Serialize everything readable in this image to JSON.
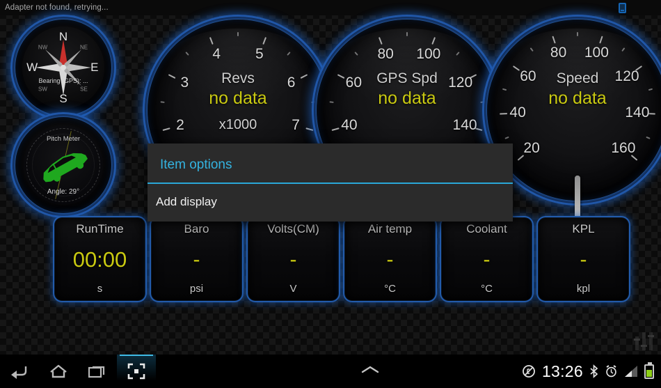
{
  "statusbar": {
    "message": "Adapter not found, retrying...",
    "tablet_icon": "tablet-icon"
  },
  "compass": {
    "name": "Compass",
    "north": "N",
    "east": "E",
    "south": "S",
    "west": "W",
    "nw": "NW",
    "ne": "NE",
    "sw": "SW",
    "se": "SE",
    "bearing": "Bearing (GPS): ..."
  },
  "pitch": {
    "title": "Pitch Meter",
    "angle": "Angle: 29°",
    "angle_value": 29
  },
  "gauges": [
    {
      "id": "revs",
      "title": "Revs",
      "value": "no data",
      "sub": "x1000",
      "ticks": [
        "2",
        "3",
        "4",
        "5",
        "6",
        "7"
      ],
      "needle_value": 0
    },
    {
      "id": "gps-speed",
      "title": "GPS Spd",
      "value": "no data",
      "sub": "",
      "ticks": [
        "40",
        "60",
        "80",
        "100",
        "120",
        "140"
      ],
      "needle_value": 0
    },
    {
      "id": "speed",
      "title": "Speed",
      "value": "no data",
      "sub": "",
      "ticks": [
        "20",
        "40",
        "60",
        "80",
        "100",
        "120",
        "140",
        "160"
      ],
      "needle_value": 0
    }
  ],
  "cards": [
    {
      "label": "RunTime",
      "value": "00:00",
      "unit": "s"
    },
    {
      "label": "Baro",
      "value": "-",
      "unit": "psi"
    },
    {
      "label": "Volts(CM)",
      "value": "-",
      "unit": "V"
    },
    {
      "label": "Air temp",
      "value": "-",
      "unit": "°C"
    },
    {
      "label": "Coolant",
      "value": "-",
      "unit": "°C"
    },
    {
      "label": "KPL",
      "value": "-",
      "unit": "kpl"
    }
  ],
  "dialog": {
    "title": "Item options",
    "items": [
      {
        "label": "Add display"
      }
    ]
  },
  "navbar": {
    "back": "back-icon",
    "home": "home-icon",
    "recents": "recent-apps-icon",
    "screenshot": "screenshot-icon",
    "expand": "expand-up-icon",
    "mute": "mute-icon",
    "clock": "13:26",
    "bluetooth": "bluetooth-icon",
    "alarm": "alarm-icon",
    "signal": "signal-icon",
    "battery": "battery-icon"
  },
  "colors": {
    "accent": "#34b3e0",
    "value_yellow": "#c9c911",
    "gauge_blue": "#2460b4",
    "battery_green": "#8fd018"
  }
}
